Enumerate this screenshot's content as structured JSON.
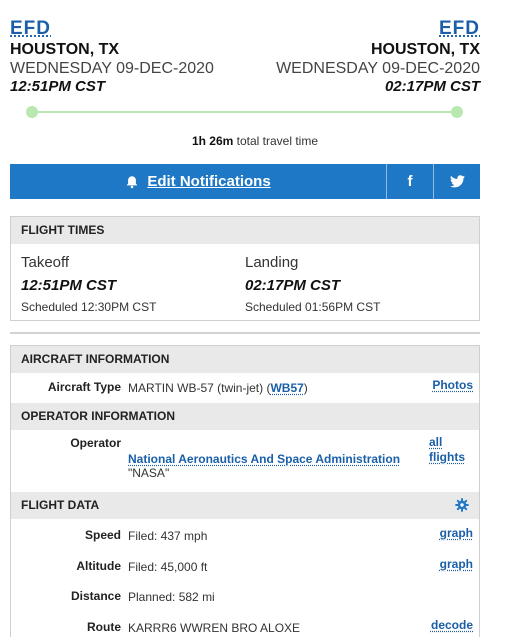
{
  "origin": {
    "code": "EFD",
    "city": "HOUSTON, TX",
    "date": "WEDNESDAY 09-DEC-2020",
    "time": "12:51PM CST"
  },
  "destination": {
    "code": "EFD",
    "city": "HOUSTON, TX",
    "date": "WEDNESDAY 09-DEC-2020",
    "time": "02:17PM CST"
  },
  "travel": {
    "duration": "1h 26m",
    "suffix": "total travel time"
  },
  "notifications": {
    "label": "Edit Notifications",
    "facebook": "f",
    "twitter_icon": "twitter-icon",
    "bell_icon": "bell-icon"
  },
  "colors": {
    "accent": "#1e78c6",
    "link": "#1a5fa8",
    "track": "#b8e8b0",
    "panel_header": "#e9e9e9"
  },
  "flight_times": {
    "title": "FLIGHT TIMES",
    "takeoff": {
      "label": "Takeoff",
      "actual": "12:51PM CST",
      "scheduled": "Scheduled 12:30PM CST"
    },
    "landing": {
      "label": "Landing",
      "actual": "02:17PM CST",
      "scheduled": "Scheduled 01:56PM CST"
    }
  },
  "aircraft": {
    "title": "AIRCRAFT INFORMATION",
    "type_label": "Aircraft Type",
    "type_prefix": "MARTIN WB-57 (twin-jet) (",
    "type_code": "WB57",
    "type_suffix": ")",
    "photos": "Photos"
  },
  "operator": {
    "title": "OPERATOR INFORMATION",
    "label": "Operator",
    "name": "National Aeronautics And Space Administration",
    "alias": "\"NASA\"",
    "all_flights": "all flights"
  },
  "flight_data": {
    "title": "FLIGHT DATA",
    "speed": {
      "label": "Speed",
      "value": "Filed: 437 mph",
      "action": "graph"
    },
    "altitude": {
      "label": "Altitude",
      "value": "Filed: 45,000 ft",
      "action": "graph"
    },
    "distance": {
      "label": "Distance",
      "value": "Planned: 582 mi"
    },
    "route": {
      "label": "Route",
      "value": "KARRR6 WWREN BRO ALOXE",
      "action": "decode"
    }
  }
}
